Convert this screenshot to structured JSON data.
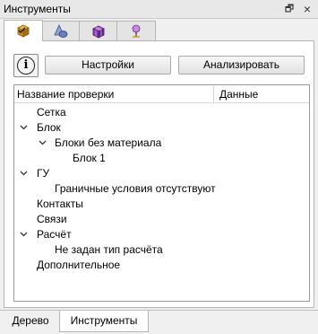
{
  "window": {
    "title": "Инструменты",
    "float_glyph": "🗗",
    "close_glyph": "×"
  },
  "tool_tabs": [
    {
      "icon": "check-cube-icon",
      "active": true
    },
    {
      "icon": "shapes-icon",
      "active": false
    },
    {
      "icon": "mesh-cube-icon",
      "active": false
    },
    {
      "icon": "probe-pin-icon",
      "active": false
    }
  ],
  "toolbar": {
    "info_glyph": "i",
    "settings_label": "Настройки",
    "analyze_label": "Анализировать"
  },
  "tree": {
    "columns": {
      "name": "Название проверки",
      "data": "Данные"
    },
    "rows": [
      {
        "label": "Сетка",
        "level": 0,
        "expanded": null
      },
      {
        "label": "Блок",
        "level": 0,
        "expanded": true
      },
      {
        "label": "Блоки без материала",
        "level": 1,
        "expanded": true
      },
      {
        "label": "Блок 1",
        "level": 2,
        "expanded": null
      },
      {
        "label": "ГУ",
        "level": 0,
        "expanded": true
      },
      {
        "label": "Граничные условия отсутствуют",
        "level": 1,
        "expanded": null
      },
      {
        "label": "Контакты",
        "level": 0,
        "expanded": null
      },
      {
        "label": "Связи",
        "level": 0,
        "expanded": null
      },
      {
        "label": "Расчёт",
        "level": 0,
        "expanded": true
      },
      {
        "label": "Не задан тип расчёта",
        "level": 1,
        "expanded": null
      },
      {
        "label": "Дополнительное",
        "level": 0,
        "expanded": null
      }
    ]
  },
  "bottom_tabs": [
    {
      "label": "Дерево",
      "active": false
    },
    {
      "label": "Инструменты",
      "active": true
    }
  ]
}
